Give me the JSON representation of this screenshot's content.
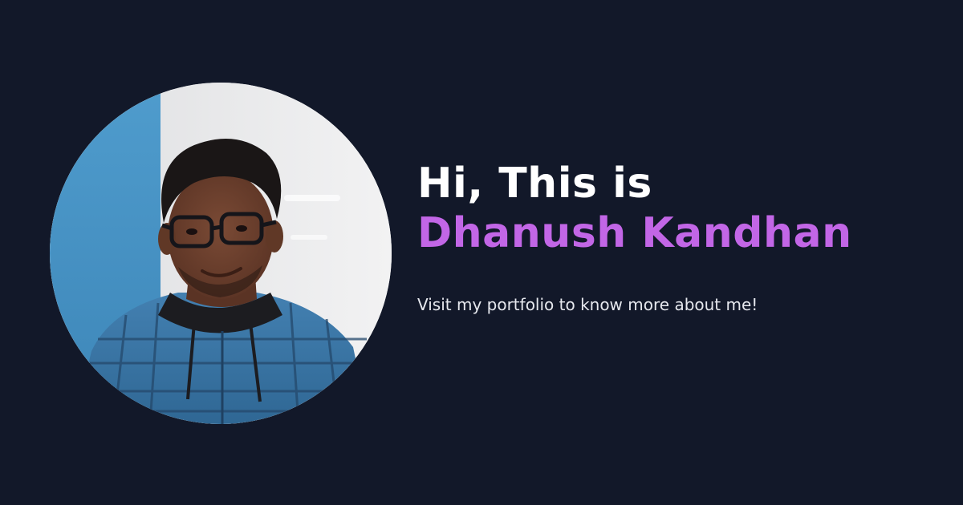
{
  "hero": {
    "greeting": "Hi, This is",
    "name": "Dhanush Kandhan",
    "tagline": "Visit my portfolio to know more about me!"
  },
  "colors": {
    "background": "#121829",
    "greeting_text": "#ffffff",
    "name_accent": "#c266e6",
    "tagline_text": "#e6e8ee",
    "avatar_wall_blue": "#4a97c8",
    "avatar_shirt_blue": "#3f77a6"
  },
  "avatar": {
    "icon": "profile-photo"
  }
}
